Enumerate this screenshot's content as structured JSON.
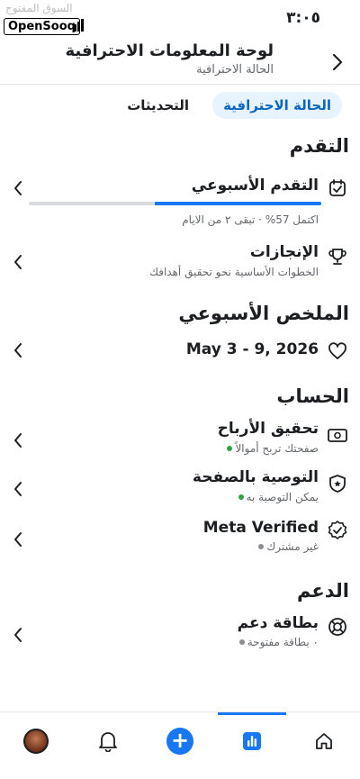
{
  "status_bar": {
    "time": "٣:٠٥"
  },
  "watermark": {
    "arabic": "السوق المفتوح",
    "label": "OpenSooq"
  },
  "header": {
    "title": "لوحة المعلومات الاحترافية",
    "subtitle": "الحالة الاحترافية"
  },
  "tabs": [
    {
      "label": "الحالة الاحترافية",
      "active": true
    },
    {
      "label": "التحديثات",
      "active": false
    }
  ],
  "progress_section": {
    "title": "التقدم",
    "weekly": {
      "title": "التقدم الأسبوعي",
      "percent": 57,
      "detail": "اكتمل 57% · تبقى ٢ من الايام"
    },
    "achievements": {
      "title": "الإنجازات",
      "subtitle": "الخطوات الأساسية نحو تحقيق أهدافك"
    }
  },
  "weekly_summary": {
    "title": "الملخص الأسبوعي",
    "date_range": "May 3 - 9, 2026"
  },
  "account": {
    "title": "الحساب",
    "items": [
      {
        "title": "تحقيق الأرباح",
        "subtitle": "صفحتك تربح أموالاً",
        "status_color": "#31a24c",
        "icon": "monetization-icon"
      },
      {
        "title": "التوصية بالصفحة",
        "subtitle": "يمكن التوصية به",
        "status_color": "#31a24c",
        "icon": "recommendation-shield-icon"
      },
      {
        "title": "Meta Verified",
        "subtitle": "غير مشترك",
        "status_color": "#8a8d91",
        "icon": "verified-badge-icon"
      }
    ]
  },
  "support": {
    "title": "الدعم",
    "inbox": {
      "title": "بطاقة دعم",
      "subtitle": "٠ بطاقة مفتوحة",
      "status_color": "#8a8d91"
    }
  },
  "bottom_nav": {
    "items": [
      "avatar",
      "bell-icon",
      "create-plus-icon",
      "dashboard-bars-icon",
      "home-icon"
    ],
    "active": "dashboard-bars-icon"
  },
  "colors": {
    "accent": "#1877f2",
    "tab_bg": "#e7f3ff",
    "tab_text": "#0a66c2",
    "muted": "#65676b"
  }
}
